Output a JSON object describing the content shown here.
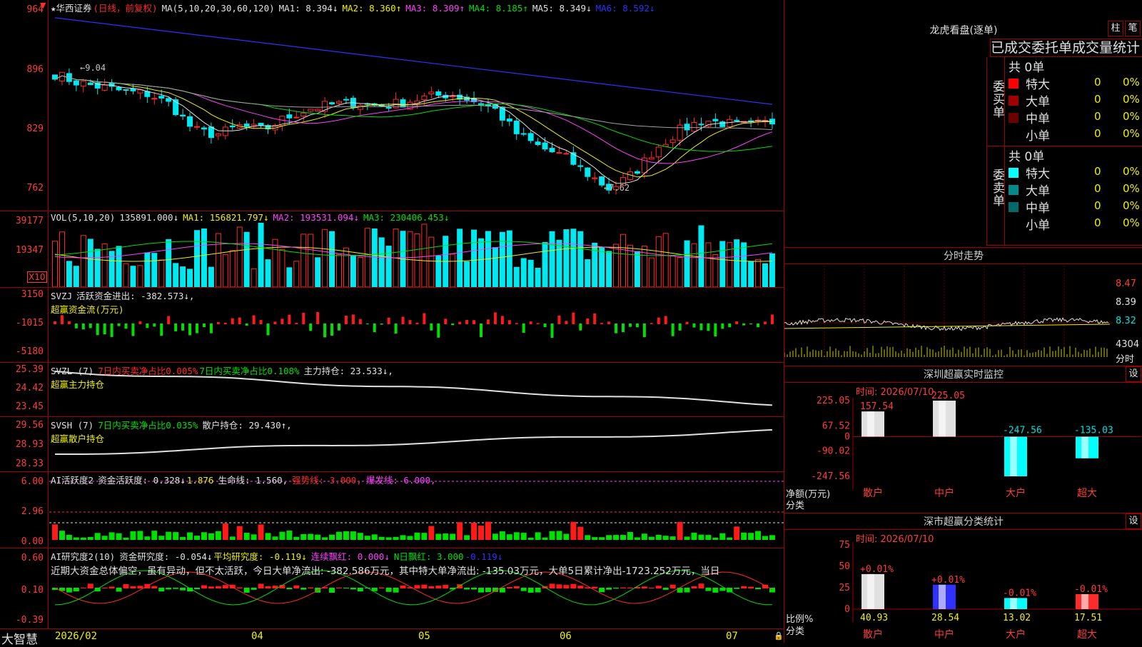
{
  "brand": "大智慧",
  "kline": {
    "title": "★华西证券",
    "mode": "(日线，前复权)",
    "ma_label": "MA(5,10,20,30,60,120)",
    "ma1": "MA1: 8.394↓",
    "ma2": "MA2: 8.360↑",
    "ma3": "MA3: 8.309↑",
    "ma4": "MA4: 8.185↑",
    "ma5": "MA5: 8.349↓",
    "ma6": "MA6: 8.592↓",
    "y_ticks": [
      "964",
      "896",
      "829",
      "762"
    ],
    "high_marker": "←9.04",
    "low_marker": "←7.62",
    "colors": {
      "up": "#ff2a2a",
      "down": "#00e8f0",
      "ma1": "#e0e0e0",
      "ma2": "#f0f000",
      "ma3": "#ff40ff",
      "ma4": "#00e000",
      "ma5": "#a0a0a0",
      "ma6": "#3030ff"
    }
  },
  "vol": {
    "title": "VOL(5,10,20)",
    "value": "135891.000↓",
    "ma1": "MA1: 156821.797↓",
    "ma2": "MA2: 193531.094↓",
    "ma3": "MA3: 230406.453↓",
    "y_ticks": [
      "39177",
      "19347"
    ],
    "unit": "X10"
  },
  "svzj": {
    "title": "SVZJ",
    "desc": "活跃资金进出: -382.573↓,",
    "subtitle": "超赢资金流(万元)",
    "y_ticks": [
      "3150",
      "-1015",
      "-5180"
    ]
  },
  "svzl": {
    "title": "SVZL (7)",
    "t1": "7日内买卖净占比0.005%",
    "t2": "7日内买卖净占比0.108%",
    "t3": "主力持仓: 23.533↓,",
    "subtitle": "超赢主力持仓",
    "y_ticks": [
      "25.39",
      "24.42",
      "23.45"
    ]
  },
  "svsh": {
    "title": "SVSH (7)",
    "t1": "7日内买卖净占比0.035%",
    "t2": "散户持仓: 29.430↑,",
    "subtitle": "超赢散户持仓",
    "y_ticks": [
      "29.56",
      "28.93",
      "28.33"
    ]
  },
  "ai1": {
    "title": "AI活跃度2",
    "t1": "资金活跃度: 0.328↓",
    "t2": "1.876",
    "t3": "生命线: 1.560,",
    "t4": "强势线: 3.000,",
    "t5": "爆发线: 6.000,",
    "y_ticks": [
      "6.00",
      "2.96",
      "0.00"
    ]
  },
  "ai2": {
    "title": "AI研究度2(10)",
    "t1": "资金研究度: -0.054↓",
    "t2": "平均研究度: -0.119↓",
    "t3": "连续飘红: 0.000↓",
    "t4": "N日飘红: 3.000",
    "t5": "-0.119↓",
    "comment": "近期大资金总体偏空，虽有异动，但不太活跃，今日大单净流出: -382.586万元，其中特大单净流出: -135.03万元，大单5日累计净出-1723.252万元，当日",
    "y_ticks": [
      "0.60",
      "0.10",
      "-0.39"
    ]
  },
  "x_axis": [
    "2026/02",
    "04",
    "05",
    "06",
    "07"
  ],
  "right": {
    "lhkp_title": "龙虎看盘(逐单)",
    "btn_zhu": "柱",
    "btn_bi": "笔",
    "header": "已成交委托单成交量统计",
    "buy_label": "委买单",
    "sell_label": "委卖单",
    "buy_total": "共 0单",
    "sell_total": "共 0单",
    "buy_rows": [
      {
        "label": "特大",
        "count": "0",
        "pct": "0%",
        "color": "#ff0000"
      },
      {
        "label": "大单",
        "count": "0",
        "pct": "0%",
        "color": "#a00000"
      },
      {
        "label": "中单",
        "count": "0",
        "pct": "0%",
        "color": "#6a0000"
      },
      {
        "label": "小单",
        "count": "0",
        "pct": "0%",
        "color": ""
      }
    ],
    "sell_rows": [
      {
        "label": "特大",
        "count": "0",
        "pct": "0%",
        "color": "#00ffff"
      },
      {
        "label": "大单",
        "count": "0",
        "pct": "0%",
        "color": "#008c8c"
      },
      {
        "label": "中单",
        "count": "0",
        "pct": "0%",
        "color": "#006a6a"
      },
      {
        "label": "小单",
        "count": "0",
        "pct": "0%",
        "color": ""
      }
    ],
    "fenshi_title": "分时走势",
    "fenshi_ticks": [
      "8.47",
      "8.39",
      "8.32"
    ],
    "fenshi_vol": "4304",
    "fenshi_label": "分时",
    "sz_title": "深圳超赢实时监控",
    "sz_btn": "设",
    "sz_time": "时间: 2026/07/10",
    "sz_ticks": [
      "225.05",
      "67.52",
      "0",
      "-90.02",
      "-247.56"
    ],
    "sz_ylabel": "净额(万元)",
    "sz_xlabel": "分类",
    "sz_cats": [
      "散户",
      "中户",
      "大户",
      "超大"
    ],
    "sz_values": [
      "157.54",
      "225.05",
      "-247.56",
      "-135.03"
    ],
    "fl_title": "深市超赢分类统计",
    "fl_btn": "设",
    "fl_time": "时间: 2026/07/10",
    "fl_ticks": [
      "75",
      "50",
      "25",
      "0"
    ],
    "fl_ylabel": "比例%",
    "fl_xlabel": "分类",
    "fl_cats": [
      "散户",
      "中户",
      "大户",
      "超大"
    ],
    "fl_values": [
      "40.93",
      "28.54",
      "13.02",
      "17.51"
    ],
    "fl_changes": [
      "+0.01%",
      "+0.01%",
      "-0.01%",
      "-0.01%"
    ],
    "fl_colors": [
      "#e0e0e0",
      "#3030ff",
      "#00ffff",
      "#ff2a2a"
    ]
  },
  "chart_data": [
    {
      "type": "bar",
      "title": "深圳超赢实时监控",
      "categories": [
        "散户",
        "中户",
        "大户",
        "超大"
      ],
      "values": [
        157.54,
        225.05,
        -247.56,
        -135.03
      ],
      "ylabel": "净额(万元)",
      "xlabel": "分类",
      "ylim": [
        -247.56,
        225.05
      ]
    },
    {
      "type": "bar",
      "title": "深市超赢分类统计",
      "categories": [
        "散户",
        "中户",
        "大户",
        "超大"
      ],
      "values": [
        40.93,
        28.54,
        13.02,
        17.51
      ],
      "ylabel": "比例%",
      "xlabel": "分类",
      "ylim": [
        0,
        75
      ]
    }
  ]
}
